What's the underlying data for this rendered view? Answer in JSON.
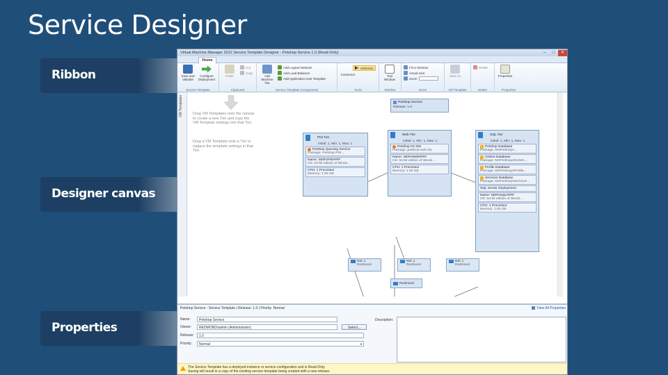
{
  "slide": {
    "title": "Service Designer",
    "callouts": [
      "Ribbon",
      "Designer canvas",
      "Properties"
    ]
  },
  "window": {
    "title": "Virtual Machine Manager 2012 Service Template Designer - Petshop Service 1.0 (Read-Only)",
    "controls": [
      "–",
      "□",
      "✕"
    ],
    "tab": "Home"
  },
  "ribbon": {
    "groups": [
      {
        "label": "Service Template",
        "buttons": [
          "Save and Validate",
          "Configure Deployment"
        ]
      },
      {
        "label": "Clipboard",
        "buttons": [
          "Paste"
        ],
        "small": [
          "Cut",
          "Copy"
        ]
      },
      {
        "label": "Service Template Components",
        "buttons": [
          "Add Machine Tier"
        ],
        "small": [
          "Add Logical Network",
          "Add Load Balancer",
          "Add Application Host Template"
        ]
      },
      {
        "label": "Tools",
        "buttons": [
          "Connector"
        ],
        "small": [
          "Selection"
        ]
      },
      {
        "label": "Window",
        "buttons": [
          "Tool Window"
        ]
      },
      {
        "label": "Zoom",
        "small": [
          "Fit to Window",
          "Actual Size",
          "Zoom"
        ]
      },
      {
        "label": "VIP Template",
        "buttons": [
          "Save As"
        ]
      },
      {
        "label": "Delete",
        "small": [
          "Delete"
        ]
      },
      {
        "label": "Properties",
        "buttons": [
          "Properties"
        ]
      }
    ]
  },
  "sidebar": {
    "label": "VM Templates"
  },
  "canvas": {
    "hint1": "Drag VM Templates onto the canvas to create a new Tier and copy the VM Template settings into that Tier.",
    "hint2": "Drag a VM Template onto a Tier to replace the template settings in that Tier.",
    "service": {
      "name": "Petshop Service",
      "release": "Release: 1.0"
    },
    "tiers": [
      {
        "name": "PNI Tier",
        "instances": "Initial: 1, Min: 1, Max: 1",
        "items": [
          {
            "title": "Petshop Queuing Service",
            "detail": "Package: Petshop PNI...",
            "icon": "orange"
          },
          {
            "title": "Name: SERVPNI####",
            "detail": "OS: 64-bit edition of Windo..."
          },
          {
            "title": "CPU: 1 Processor",
            "detail": "Memory: 1.00 GB"
          }
        ]
      },
      {
        "name": "Web Tier",
        "instances": "Initial: 1, Min: 1, Max: 1",
        "items": [
          {
            "title": "Petshop IIS Site",
            "detail": "Package: petshop-web.zip",
            "icon": "orange"
          },
          {
            "title": "Name: SERVWeb####",
            "detail": "OS: 64-bit edition of Windo..."
          },
          {
            "title": "CPU: 1 Processor",
            "detail": "Memory: 1.00 GB"
          }
        ]
      },
      {
        "name": "SQL Tier",
        "instances": "Initial: 1, Min: 1, Max: 1",
        "items": [
          {
            "title": "Petshop Database",
            "detail": "Package: MSPetshop4...",
            "icon": "yellow"
          },
          {
            "title": "Orders Database",
            "detail": "Package: MSPetshop4Orders...",
            "icon": "yellow"
          },
          {
            "title": "Profile Database",
            "detail": "Package: MSPetshop4Profile...",
            "icon": "yellow"
          },
          {
            "title": "Services Database",
            "detail": "Package: MSPetshop4Services...",
            "icon": "yellow"
          },
          {
            "title": "SQL Server Deployment",
            "detail": ""
          },
          {
            "title": "Name: SERVSQL####",
            "detail": "OS: 64-bit edition of Windo..."
          },
          {
            "title": "CPU: 1 Processor",
            "detail": "Memory: 1.00 GB"
          }
        ]
      }
    ],
    "nics": [
      {
        "name": "NIC 1",
        "network": "Redmond"
      },
      {
        "name": "NIC 1",
        "network": "Redmond"
      },
      {
        "name": "NIC 1",
        "network": "Redmond"
      }
    ],
    "network": "Redmond"
  },
  "properties": {
    "header": "Petshop Service - Service Template | Release: 1.0 | Priority: Normal",
    "view_all": "View All Properties",
    "name_label": "Name:",
    "name_value": "Petshop Service",
    "owner_label": "Owner:",
    "owner_value": "REDMOND\\admin (Administrator)",
    "select_label": "Select...",
    "release_label": "Release:",
    "release_value": "1.0",
    "priority_label": "Priority:",
    "priority_value": "Normal",
    "description_label": "Description:",
    "warning_line1": "The Service Template has a deployed instance or service configuration and is Read-Only.",
    "warning_line2": "Saving will result in a copy of the existing service template being created with a new release."
  }
}
